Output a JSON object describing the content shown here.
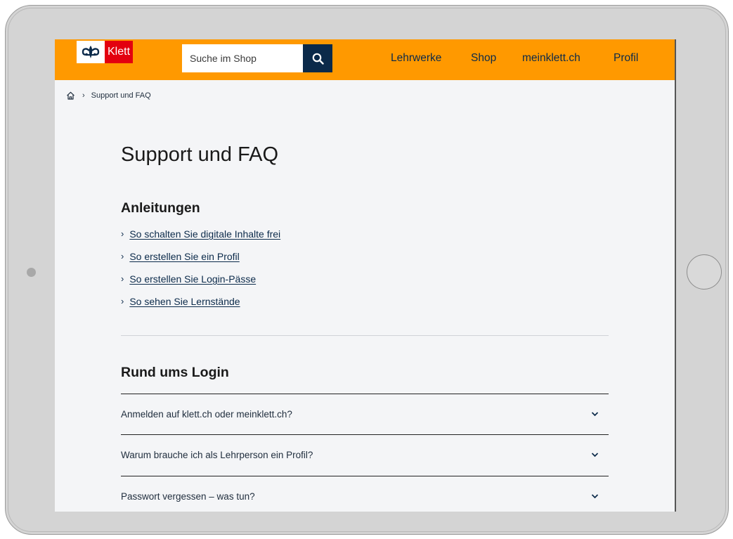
{
  "header": {
    "logo_text": "Klett",
    "search": {
      "placeholder": "Suche im Shop"
    },
    "nav": [
      "Lehrwerke",
      "Shop",
      "meinklett.ch",
      "Profil"
    ]
  },
  "breadcrumb": {
    "current": "Support und FAQ"
  },
  "page_title": "Support und FAQ",
  "guides": {
    "heading": "Anleitungen",
    "links": [
      "So schalten Sie digitale Inhalte frei",
      "So erstellen Sie ein Profil",
      "So erstellen Sie Login-Pässe",
      "So sehen Sie Lernstände"
    ]
  },
  "login": {
    "heading": "Rund ums Login",
    "faq": [
      "Anmelden auf klett.ch oder meinklett.ch?",
      "Warum brauche ich als Lehrperson ein Profil?",
      "Passwort vergessen – was tun?"
    ]
  },
  "colors": {
    "header": "#ff9900",
    "navy": "#0b2a4a",
    "logo_red": "#e3000f"
  }
}
